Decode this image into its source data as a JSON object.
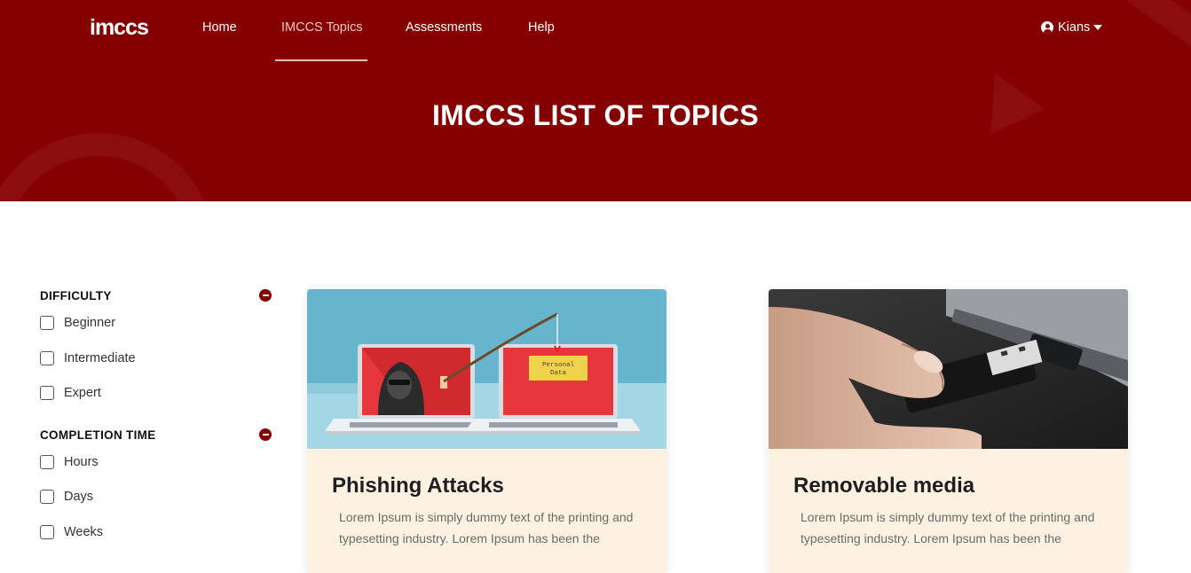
{
  "nav": {
    "logo": "imccs",
    "links": [
      "Home",
      "IMCCS Topics",
      "Assessments",
      "Help"
    ],
    "active_link": "IMCCS Topics",
    "user": "Kians"
  },
  "hero": {
    "title": "IMCCS LIST OF TOPICS"
  },
  "filters": [
    {
      "title": "DIFFICULTY",
      "options": [
        "Beginner",
        "Intermediate",
        "Expert"
      ]
    },
    {
      "title": "COMPLETION TIME",
      "options": [
        "Hours",
        "Days",
        "Weeks"
      ]
    }
  ],
  "cards": [
    {
      "title": "Phishing Attacks",
      "description": "Lorem Ipsum is simply dummy text of the printing and typesetting industry. Lorem Ipsum has been the",
      "image_note": "Personal Data",
      "image_note_lines": [
        "Personal",
        "Data"
      ]
    },
    {
      "title": "Removable media",
      "description": "Lorem Ipsum is simply dummy text of the printing and typesetting industry. Lorem Ipsum has been the"
    }
  ],
  "colors": {
    "brand": "#850000",
    "card_body": "#fdf2e2"
  },
  "icons": [
    "user-icon",
    "caret-down-icon",
    "collapse-minus-icon",
    "checkbox-icon"
  ]
}
